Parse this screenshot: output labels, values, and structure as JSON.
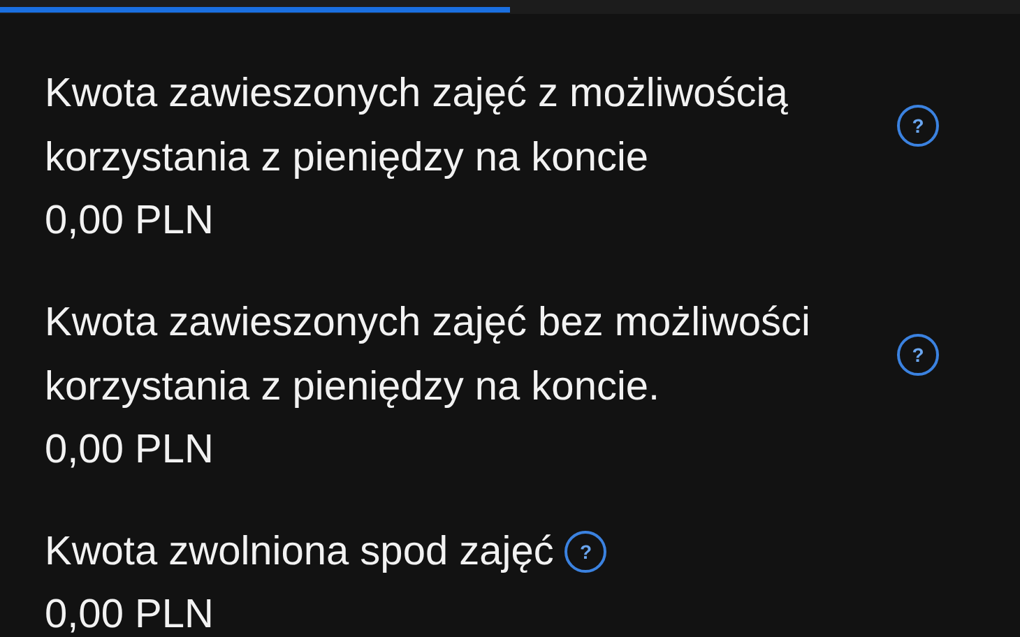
{
  "progress": {
    "level": 0.5
  },
  "items": [
    {
      "label": "Kwota zawieszonych zajęć z możliwością korzystania z pieniędzy na koncie",
      "help_icon": "?",
      "value": "0,00 PLN"
    },
    {
      "label": "Kwota zawieszonych zajęć bez możliwości korzystania z pieniędzy na koncie.",
      "help_icon": "?",
      "value": "0,00 PLN"
    },
    {
      "label": "Kwota zwolniona spod zajęć",
      "help_icon": "?",
      "value": "0,00 PLN"
    }
  ]
}
